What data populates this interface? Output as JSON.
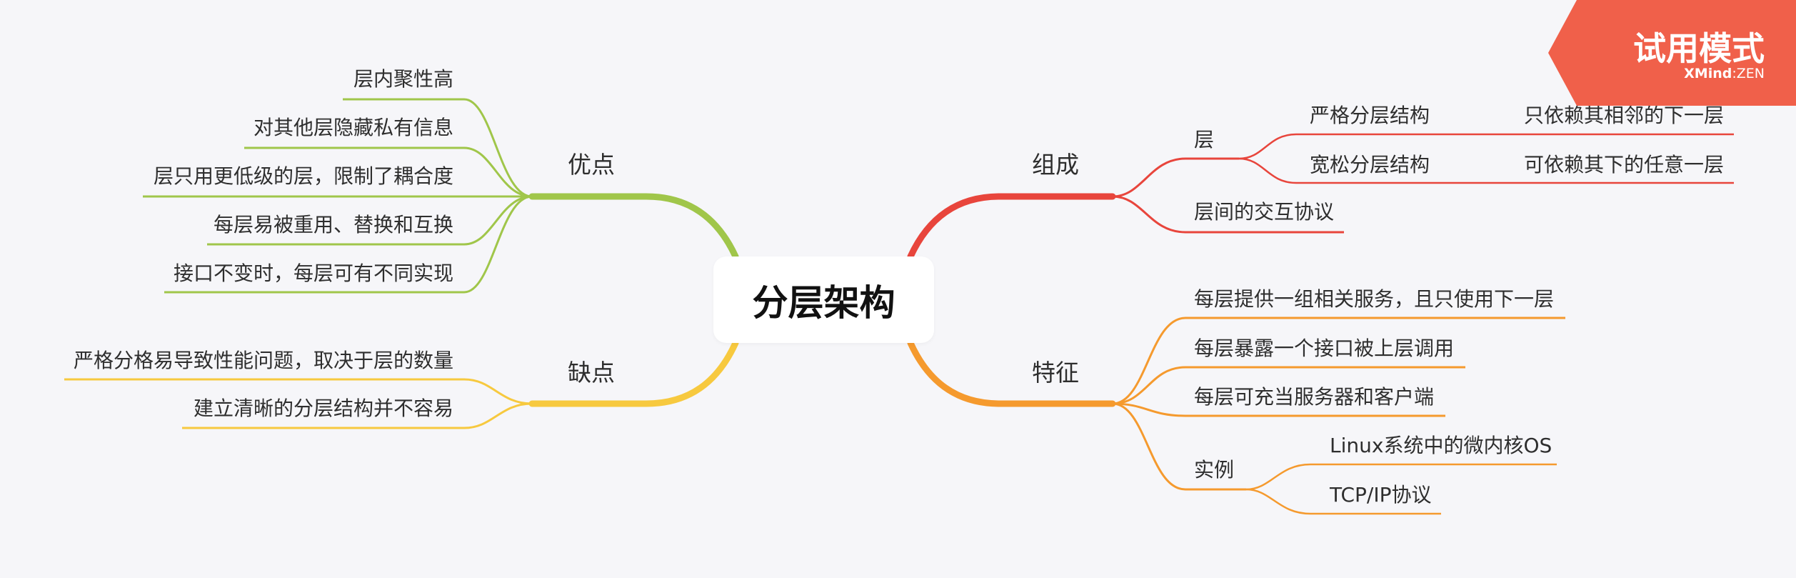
{
  "root": {
    "label": "分层架构"
  },
  "colors": {
    "composition": "#e8453c",
    "features": "#f59a2e",
    "pros": "#a0c64a",
    "cons": "#f7c93f",
    "badge": "#f0604a",
    "text": "#2e2e2e"
  },
  "branches": {
    "composition": {
      "label": "组成",
      "layer": {
        "label": "层",
        "children": [
          {
            "label": "严格分层结构",
            "detail": "只依赖其相邻的下一层"
          },
          {
            "label": "宽松分层结构",
            "detail": "可依赖其下的任意一层"
          }
        ]
      },
      "protocol": {
        "label": "层间的交互协议"
      }
    },
    "features": {
      "label": "特征",
      "items": [
        {
          "label": "每层提供一组相关服务，且只使用下一层"
        },
        {
          "label": "每层暴露一个接口被上层调用"
        },
        {
          "label": "每层可充当服务器和客户端"
        }
      ],
      "examples": {
        "label": "实例",
        "children": [
          {
            "label": "Linux系统中的微内核OS"
          },
          {
            "label": "TCP/IP协议"
          }
        ]
      }
    },
    "pros": {
      "label": "优点",
      "items": [
        {
          "label": "层内聚性高"
        },
        {
          "label": "对其他层隐藏私有信息"
        },
        {
          "label": "层只用更低级的层，限制了耦合度"
        },
        {
          "label": "每层易被重用、替换和互换"
        },
        {
          "label": "接口不变时，每层可有不同实现"
        }
      ]
    },
    "cons": {
      "label": "缺点",
      "items": [
        {
          "label": "严格分格易导致性能问题，取决于层的数量"
        },
        {
          "label": "建立清晰的分层结构并不容易"
        }
      ]
    }
  },
  "badge": {
    "title": "试用模式",
    "brand": "XMind",
    "edition": "ZEN"
  }
}
